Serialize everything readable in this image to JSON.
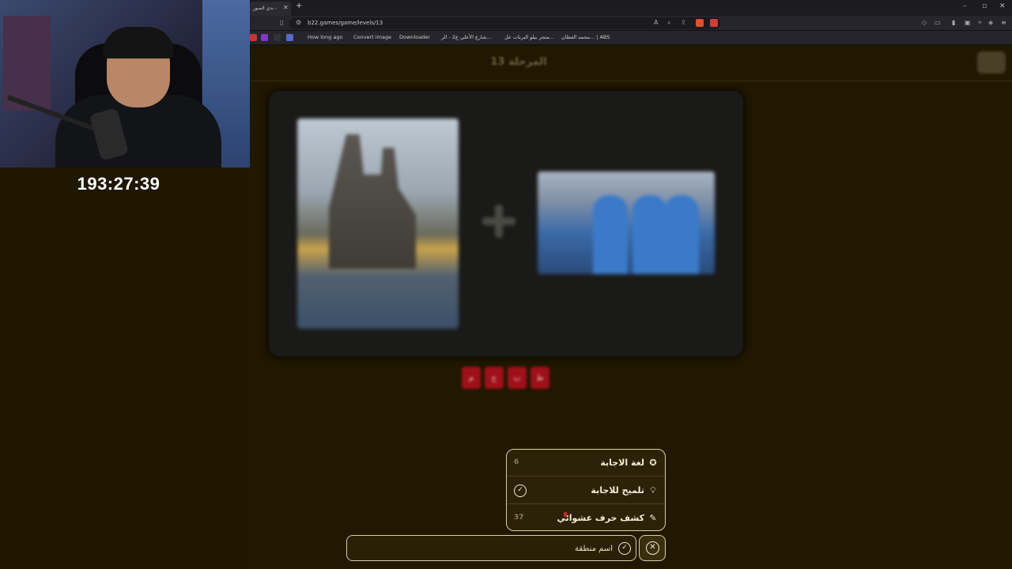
{
  "stream": {
    "timer": "193:27:39"
  },
  "browser": {
    "tab_title": "بدي الصور -",
    "url": "b22.games/game/levels/13",
    "bookmarks": [
      "How long ago",
      "Convert image",
      "Downloader",
      "شارع الأعلى ع2 - الر...",
      "متجر بيلو البرنات عل...",
      "محمد العطان... | ABS"
    ]
  },
  "game": {
    "level_title": "المرحلة 13",
    "answer_slots": [
      "م",
      "ع",
      "ب",
      "ط"
    ],
    "hints": [
      {
        "label": "لغة الاجابة",
        "icon": "check-badge-icon",
        "count": "6"
      },
      {
        "label": "تلميح للاجابة",
        "icon": "lightbulb-icon",
        "status": "✓"
      },
      {
        "label": "كشف حرف عشوائي",
        "icon": "pencil-icon",
        "count": "37"
      }
    ],
    "input": {
      "placeholder": "اسم منطقة",
      "value": ""
    }
  },
  "colors": {
    "page_bg": "#201800",
    "menu_border": "#d8cfa8",
    "slot_red": "#a01018"
  }
}
